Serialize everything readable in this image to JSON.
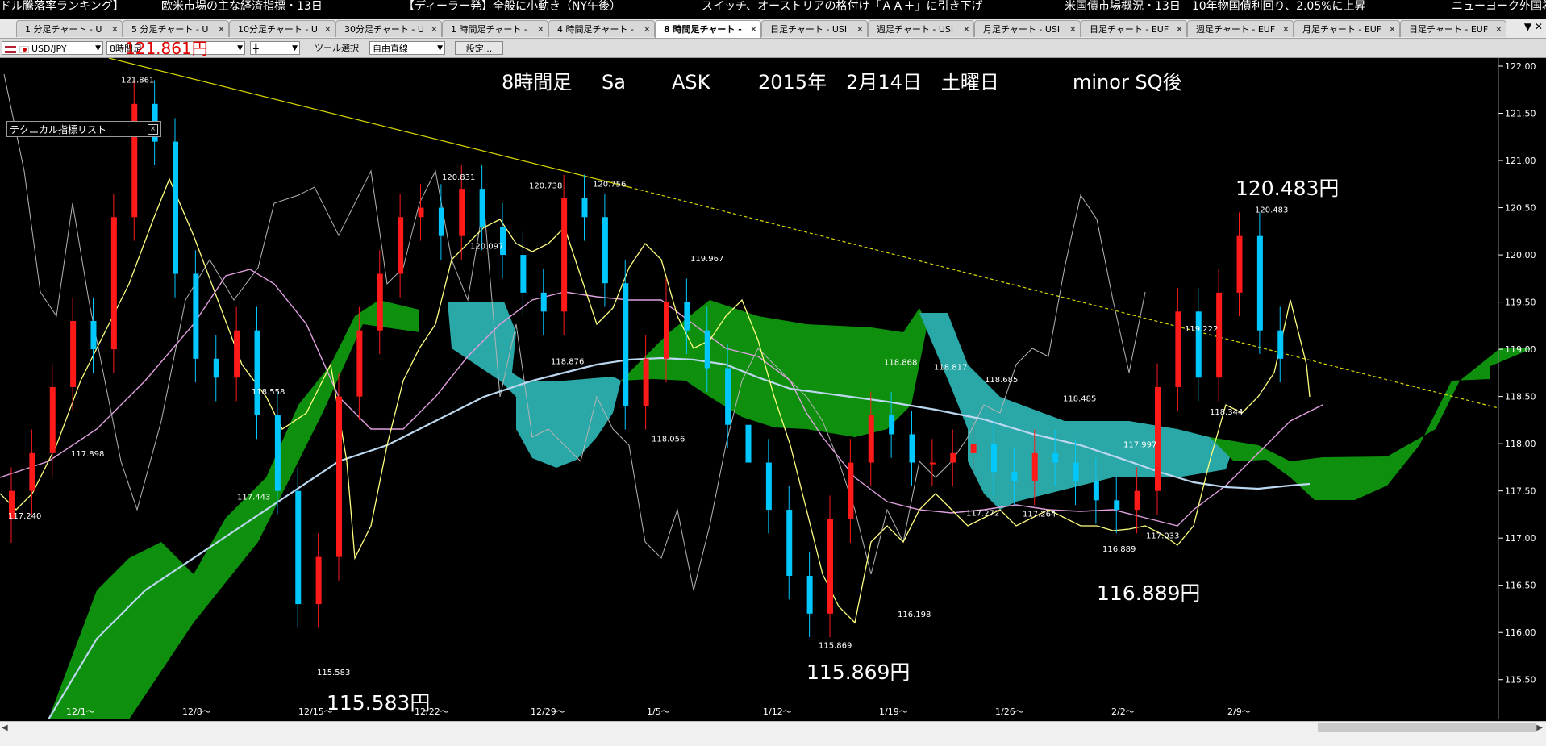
{
  "ticker": [
    "ドル騰落率ランキング】",
    "欧米市場の主な経済指標・13日",
    "【ディーラー発】全般に小動き（NY午後）",
    "スイッチ、オーストリアの格付け「ＡＡ＋」に引き下げ",
    "米国債市場概況・13日　10年物国債利回り、2.05%に上昇",
    "ニューヨーク外国為"
  ],
  "tabs": [
    {
      "label": "1 分足チャート - U",
      "active": false
    },
    {
      "label": "5 分足チャート - U",
      "active": false
    },
    {
      "label": "10分足チャート - U",
      "active": false
    },
    {
      "label": "30分足チャート - U",
      "active": false
    },
    {
      "label": "1 時間足チャート -",
      "active": false
    },
    {
      "label": "4 時間足チャート -",
      "active": false
    },
    {
      "label": "8 時間足チャート -",
      "active": true
    },
    {
      "label": "日足チャート - USI",
      "active": false
    },
    {
      "label": "週足チャート - USI",
      "active": false
    },
    {
      "label": "月足チャート - USI",
      "active": false
    },
    {
      "label": "日足チャート - EUF",
      "active": false
    },
    {
      "label": "週足チャート - EUF",
      "active": false
    },
    {
      "label": "月足チャート - EUF",
      "active": false
    },
    {
      "label": "日足チャート - EUF",
      "active": false
    }
  ],
  "toolbar": {
    "pair": "USD/JPY",
    "timeframe": "8時間足",
    "overlay_red": "121.861円",
    "candle_symbol": "╋",
    "tool_label": "ツール選択",
    "tool_value": "自由直線",
    "settings_label": "設定..."
  },
  "panel": {
    "label": "テクニカル指標リスト"
  },
  "chart_header": {
    "timeframe": "8時間足",
    "sa": "Sa",
    "ask": "ASK",
    "date": "2015年　2月14日　土曜日",
    "note": "minor SQ後"
  },
  "annotations_white": [
    {
      "text": "121.861円"
    },
    {
      "text": "115.583円"
    },
    {
      "text": "115.869円"
    },
    {
      "text": "116.889円"
    },
    {
      "text": "120.483円"
    }
  ],
  "colors": {
    "up_candle": "#ff1a1a",
    "down_candle": "#00c8ff",
    "cloud_green": "#0e8f0e",
    "cloud_teal": "#2aa8a8",
    "trendline": "#d8d800",
    "ma_lightblue": "#bcd8f0",
    "ma_pink": "#e0a0e0",
    "tenkan_yellow": "#ffff80",
    "chikou": "#b4b4b4"
  },
  "chart_data": {
    "type": "candlestick",
    "instrument": "USD/JPY",
    "y_axis": {
      "min": 115.25,
      "max": 122.0,
      "ticks": [
        "122.00",
        "121.50",
        "121.00",
        "120.50",
        "120.00",
        "119.50",
        "119.00",
        "118.50",
        "118.00",
        "117.50",
        "117.00",
        "116.50",
        "116.00",
        "115.50"
      ]
    },
    "x_ticks": [
      "12/1～",
      "12/8～",
      "12/15～",
      "12/22～",
      "12/29～",
      "1/5～",
      "1/12～",
      "1/19～",
      "1/26～",
      "2/2～",
      "2/9～"
    ],
    "price_labels": [
      "121.861",
      "117.240",
      "117.898",
      "118.558",
      "117.443",
      "115.583",
      "120.831",
      "120.097",
      "120.738",
      "120.756",
      "118.876",
      "118.056",
      "119.967",
      "115.869",
      "118.868",
      "118.817",
      "116.198",
      "117.272",
      "118.685",
      "117.264",
      "118.485",
      "117.997",
      "116.889",
      "117.033",
      "119.222",
      "118.344",
      "120.483"
    ],
    "closes": [
      117.5,
      117.9,
      118.6,
      119.3,
      119.0,
      120.4,
      121.6,
      121.2,
      119.8,
      118.9,
      118.7,
      119.2,
      118.3,
      117.5,
      116.3,
      116.8,
      118.5,
      119.2,
      119.8,
      120.4,
      120.5,
      120.2,
      120.7,
      120.3,
      120.0,
      119.6,
      119.4,
      120.6,
      120.4,
      119.7,
      118.4,
      118.9,
      119.5,
      119.2,
      118.8,
      118.2,
      117.8,
      117.3,
      116.6,
      116.2,
      117.2,
      117.8,
      118.3,
      118.1,
      117.8,
      117.8,
      117.9,
      118.0,
      117.7,
      117.6,
      117.9,
      117.8,
      117.6,
      117.4,
      117.3,
      117.5,
      118.6,
      119.4,
      118.7,
      119.6,
      120.2,
      119.2,
      118.9
    ]
  }
}
